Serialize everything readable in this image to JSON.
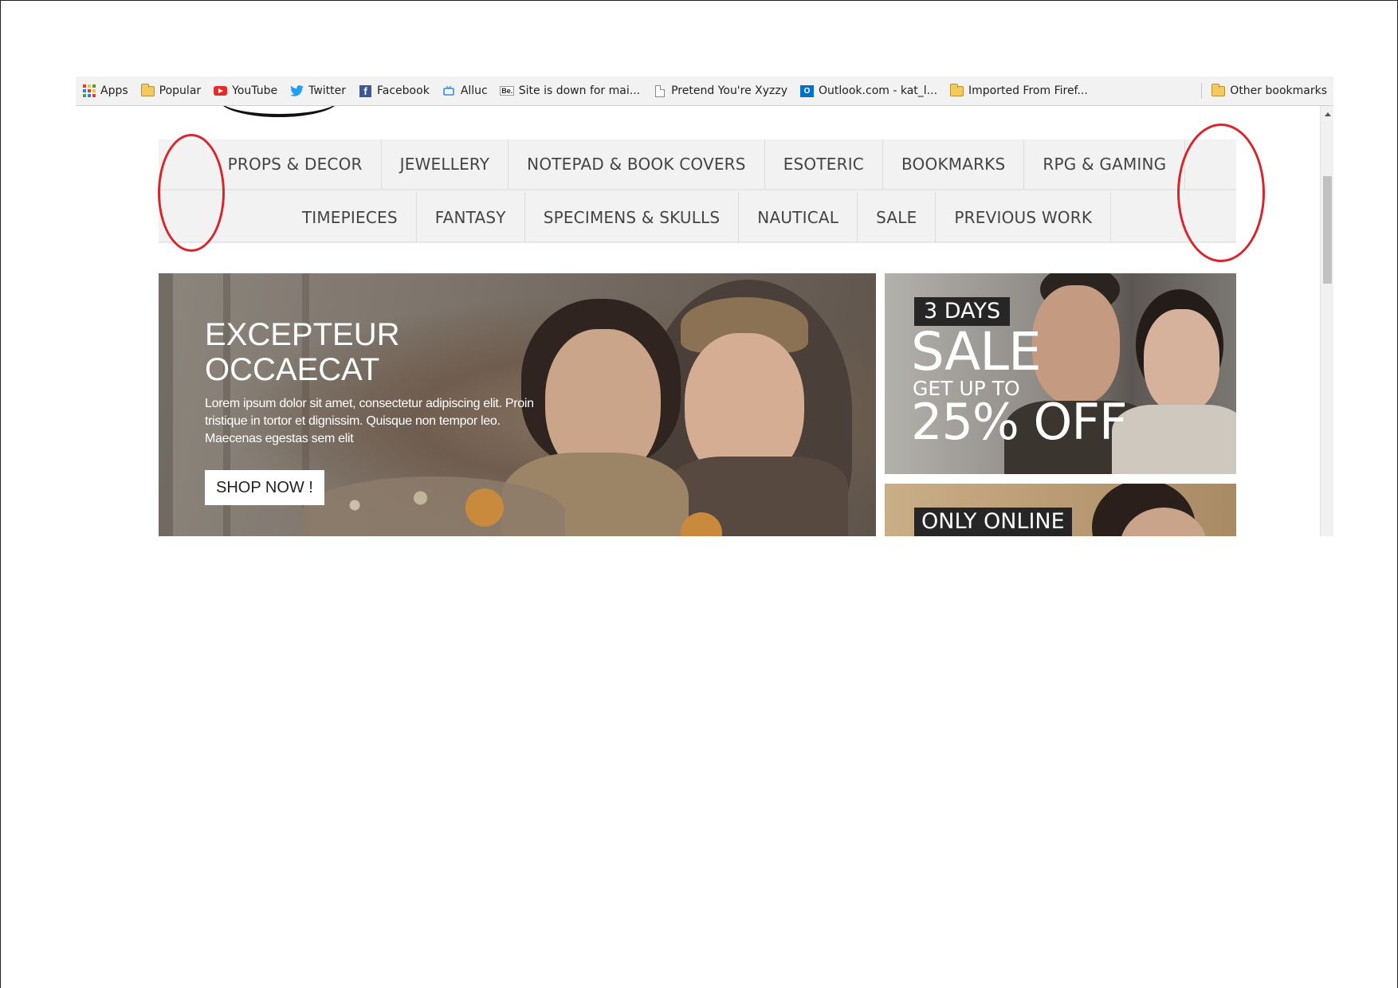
{
  "bookmarks": [
    {
      "icon": "apps-icon",
      "label": "Apps"
    },
    {
      "icon": "folder-icon",
      "label": "Popular"
    },
    {
      "icon": "youtube-icon",
      "label": "YouTube"
    },
    {
      "icon": "twitter-icon",
      "label": "Twitter"
    },
    {
      "icon": "facebook-icon",
      "label": "Facebook"
    },
    {
      "icon": "tv-icon",
      "label": "Alluc"
    },
    {
      "icon": "behance-icon",
      "label": "Site is down for mai..."
    },
    {
      "icon": "page-icon",
      "label": "Pretend You're Xyzzy"
    },
    {
      "icon": "outlook-icon",
      "label": "Outlook.com - kat_l..."
    },
    {
      "icon": "folder-icon",
      "label": "Imported From Firef..."
    }
  ],
  "other_bookmarks": "Other bookmarks",
  "nav": {
    "row1": [
      "PROPS & DECOR",
      "JEWELLERY",
      "NOTEPAD & BOOK COVERS",
      "ESOTERIC",
      "BOOKMARKS",
      "RPG & GAMING"
    ],
    "row2": [
      "TIMEPIECES",
      "FANTASY",
      "SPECIMENS & SKULLS",
      "NAUTICAL",
      "SALE",
      "PREVIOUS WORK"
    ]
  },
  "hero": {
    "title": "EXCEPTEUR\nOCCAECAT",
    "body": "Lorem ipsum dolor sit amet, consectetur adipiscing elit. Proin tristique in tortor et dignissim. Quisque non tempor leo. Maecenas egestas sem elit",
    "button": "SHOP NOW !"
  },
  "promo_sale": {
    "badge": "3 DAYS",
    "headline": "SALE",
    "subline": "GET UP TO",
    "discount": "25% OFF"
  },
  "promo_online": {
    "badge": "ONLY ONLINE"
  },
  "colors": {
    "annotation": "#d7262d",
    "nav_background": "#f2f2f2",
    "nav_text": "#444444",
    "badge_background": "#262626"
  }
}
